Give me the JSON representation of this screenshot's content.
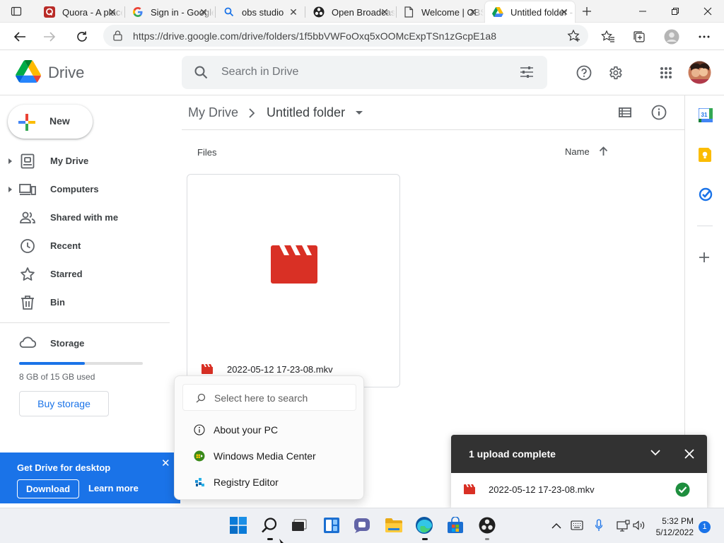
{
  "browser": {
    "tabs": [
      {
        "label": "Quora - A place to share knowledge",
        "icon": "quora-icon"
      },
      {
        "label": "Sign in - Google Accounts",
        "icon": "google-icon"
      },
      {
        "label": "obs studio",
        "icon": "search-icon"
      },
      {
        "label": "Open Broadcaster Software",
        "icon": "obs-icon"
      },
      {
        "label": "Welcome | OBS",
        "icon": "page-icon"
      },
      {
        "label": "Untitled folder - Google Drive",
        "icon": "drive-icon",
        "active": true
      }
    ],
    "url": "https://drive.google.com/drive/folders/1f5bbVWFoOxq5xOOMcExpTSn1zGcpE1a8"
  },
  "header": {
    "app_name": "Drive",
    "search_placeholder": "Search in Drive"
  },
  "sidebar": {
    "new_label": "New",
    "items": [
      {
        "label": "My Drive",
        "icon": "my-drive-icon",
        "expandable": true
      },
      {
        "label": "Computers",
        "icon": "computers-icon",
        "expandable": true
      },
      {
        "label": "Shared with me",
        "icon": "shared-icon"
      },
      {
        "label": "Recent",
        "icon": "clock-icon"
      },
      {
        "label": "Starred",
        "icon": "star-icon"
      },
      {
        "label": "Bin",
        "icon": "trash-icon"
      }
    ],
    "storage": {
      "label": "Storage",
      "used_text": "8 GB of 15 GB used",
      "used_fraction": 0.533,
      "buy_label": "Buy storage"
    }
  },
  "main": {
    "breadcrumb": [
      "My Drive",
      "Untitled folder"
    ],
    "section_label": "Files",
    "sort_label": "Name",
    "files": [
      {
        "name": "2022-05-12 17-23-08.mkv",
        "type": "video"
      }
    ]
  },
  "promo": {
    "title": "Get Drive for desktop",
    "download_label": "Download",
    "learn_label": "Learn more"
  },
  "popup": {
    "search_placeholder": "Select here to search",
    "items": [
      {
        "label": "About your PC",
        "icon": "info-icon"
      },
      {
        "label": "Windows Media Center",
        "icon": "media-center-icon"
      },
      {
        "label": "Registry Editor",
        "icon": "registry-icon"
      }
    ]
  },
  "upload": {
    "title": "1 upload complete",
    "file": "2022-05-12 17-23-08.mkv"
  },
  "taskbar": {
    "time": "5:32 PM",
    "date": "5/12/2022",
    "notifications": "1"
  },
  "colors": {
    "accent": "#1a73e8",
    "video_red": "#d93025",
    "success_green": "#1e8e3e",
    "toast_dark": "#323232"
  }
}
